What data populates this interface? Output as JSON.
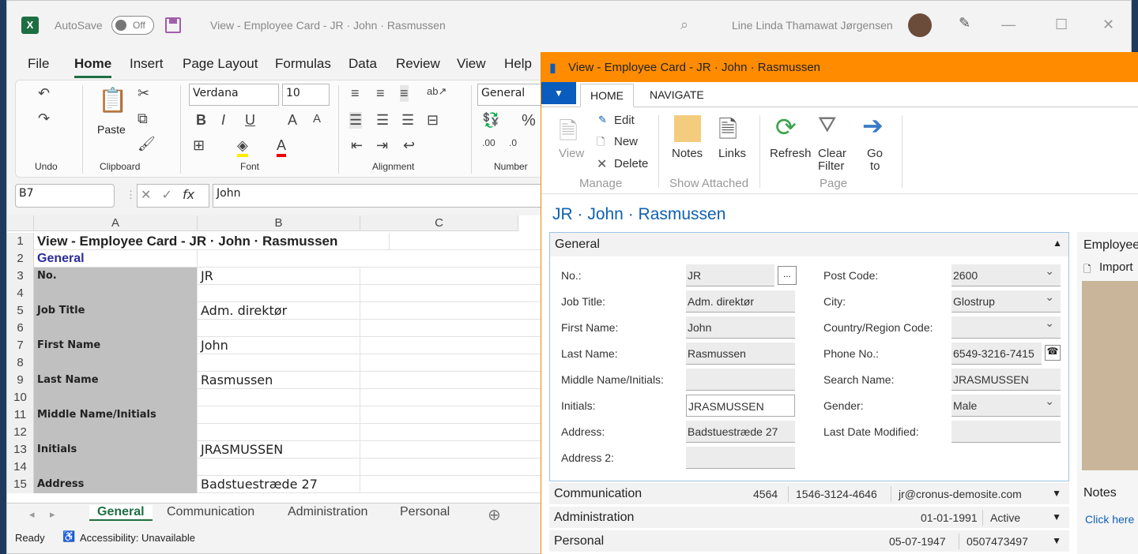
{
  "excel": {
    "autosave_label": "AutoSave",
    "autosave_state": "Off",
    "doc_title": "View - Employee Card - JR · John · Rasmussen",
    "user_name": "Line Linda Thamawat Jørgensen",
    "menu": [
      "File",
      "Home",
      "Insert",
      "Page Layout",
      "Formulas",
      "Data",
      "Review",
      "View",
      "Help"
    ],
    "ribbon": {
      "undo": "Undo",
      "paste": "Paste",
      "clipboard": "Clipboard",
      "font_name": "Verdana",
      "font_size": "10",
      "font": "Font",
      "alignment": "Alignment",
      "number_format": "General",
      "number": "Number"
    },
    "name_box": "B7",
    "formula_value": "John",
    "columns": [
      "A",
      "B",
      "C"
    ],
    "rows": [
      {
        "n": "1",
        "a": "View - Employee Card - JR · John · Rasmussen",
        "b": ""
      },
      {
        "n": "2",
        "a": "General",
        "b": ""
      },
      {
        "n": "3",
        "a": "No.",
        "b": "JR"
      },
      {
        "n": "4",
        "a": "",
        "b": ""
      },
      {
        "n": "5",
        "a": "Job Title",
        "b": "Adm. direktør"
      },
      {
        "n": "6",
        "a": "",
        "b": ""
      },
      {
        "n": "7",
        "a": "First Name",
        "b": "John"
      },
      {
        "n": "8",
        "a": "",
        "b": ""
      },
      {
        "n": "9",
        "a": "Last Name",
        "b": "Rasmussen"
      },
      {
        "n": "10",
        "a": "",
        "b": ""
      },
      {
        "n": "11",
        "a": "Middle Name/Initials",
        "b": ""
      },
      {
        "n": "12",
        "a": "",
        "b": ""
      },
      {
        "n": "13",
        "a": "Initials",
        "b": "JRASMUSSEN"
      },
      {
        "n": "14",
        "a": "",
        "b": ""
      },
      {
        "n": "15",
        "a": "Address",
        "b": "Badstuestræde 27"
      }
    ],
    "sheets": [
      "General",
      "Communication",
      "Administration",
      "Personal"
    ],
    "status_ready": "Ready",
    "status_accessibility": "Accessibility: Unavailable"
  },
  "nav": {
    "title": "View - Employee Card - JR · John · Rasmussen",
    "tabs": [
      "HOME",
      "NAVIGATE"
    ],
    "ribbon": {
      "view": "View",
      "edit": "Edit",
      "new": "New",
      "delete": "Delete",
      "manage": "Manage",
      "notes": "Notes",
      "links": "Links",
      "show_attached": "Show Attached",
      "refresh": "Refresh",
      "clear_filter_1": "Clear",
      "clear_filter_2": "Filter",
      "go_to_1": "Go",
      "go_to_2": "to",
      "page": "Page"
    },
    "heading": "JR · John · Rasmussen",
    "general_label": "General",
    "left_fields": [
      {
        "label": "No.:",
        "value": "JR"
      },
      {
        "label": "Job Title:",
        "value": "Adm. direktør"
      },
      {
        "label": "First Name:",
        "value": "John"
      },
      {
        "label": "Last Name:",
        "value": "Rasmussen"
      },
      {
        "label": "Middle Name/Initials:",
        "value": ""
      },
      {
        "label": "Initials:",
        "value": "JRASMUSSEN"
      },
      {
        "label": "Address:",
        "value": "Badstuestræde 27"
      },
      {
        "label": "Address 2:",
        "value": ""
      }
    ],
    "right_fields": [
      {
        "label": "Post Code:",
        "value": "2600"
      },
      {
        "label": "City:",
        "value": "Glostrup"
      },
      {
        "label": "Country/Region Code:",
        "value": ""
      },
      {
        "label": "Phone No.:",
        "value": "6549-3216-7415"
      },
      {
        "label": "Search Name:",
        "value": "JRASMUSSEN"
      },
      {
        "label": "Gender:",
        "value": "Male"
      },
      {
        "label": "Last Date Modified:",
        "value": ""
      }
    ],
    "communication": {
      "label": "Communication",
      "v1": "4564",
      "v2": "1546-3124-4646",
      "v3": "jr@cronus-demosite.com"
    },
    "administration": {
      "label": "Administration",
      "v1": "01-01-1991",
      "v2": "Active"
    },
    "personal": {
      "label": "Personal",
      "v1": "05-07-1947",
      "v2": "0507473497"
    },
    "side": {
      "employee": "Employee",
      "import": "Import",
      "notes": "Notes",
      "click_here": "Click here"
    }
  },
  "colors": {
    "excel_green": "#1d6f42",
    "nav_orange": "#ff8c00",
    "nav_blue": "#0a5cbd"
  }
}
